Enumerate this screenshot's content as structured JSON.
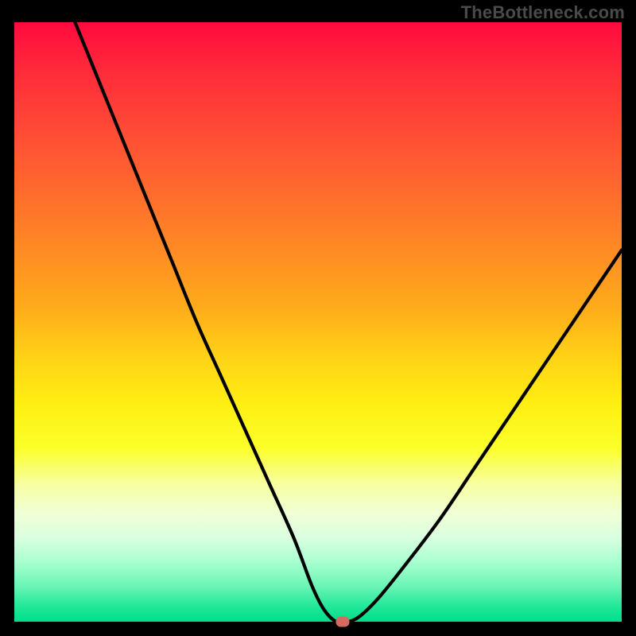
{
  "watermark": "TheBottleneck.com",
  "chart_data": {
    "type": "line",
    "title": "",
    "xlabel": "",
    "ylabel": "",
    "xlim": [
      0,
      100
    ],
    "ylim": [
      0,
      100
    ],
    "background_gradient": {
      "direction": "vertical",
      "stops": [
        {
          "pos": 0,
          "color": "#ff0a3e",
          "meaning": "severe-bottleneck"
        },
        {
          "pos": 50,
          "color": "#ffd316",
          "meaning": "moderate"
        },
        {
          "pos": 100,
          "color": "#00de8c",
          "meaning": "no-bottleneck"
        }
      ]
    },
    "series": [
      {
        "name": "bottleneck-curve",
        "x": [
          10,
          14,
          18,
          22,
          26,
          30,
          34,
          38,
          42,
          46,
          49,
          51,
          53,
          55,
          57,
          60,
          64,
          70,
          76,
          84,
          92,
          100
        ],
        "y": [
          100,
          90,
          80,
          70,
          60,
          50,
          41,
          32,
          23,
          14,
          6,
          2,
          0,
          0,
          1,
          4,
          9,
          17,
          26,
          38,
          50,
          62
        ]
      }
    ],
    "marker": {
      "x": 54,
      "y": 0,
      "color": "#d46a60"
    }
  }
}
